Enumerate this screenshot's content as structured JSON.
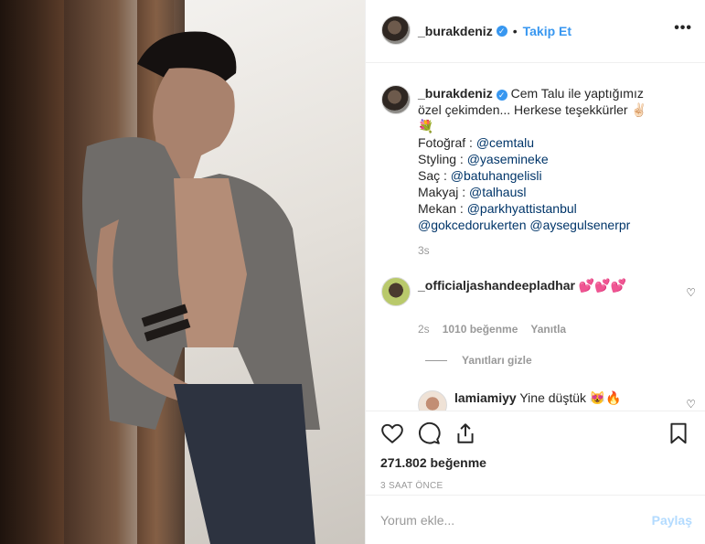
{
  "header": {
    "username": "_burakdeniz",
    "verified_icon": "verified-badge-icon",
    "dot": "•",
    "follow": "Takip Et",
    "more": "•••"
  },
  "caption": {
    "username": "_burakdeniz",
    "text": "Cem Talu ile yaptığımız özel çekimden... Herkese teşekkürler ✌🏻💐",
    "lines": [
      {
        "label": "Fotoğraf : ",
        "mention": "@cemtalu"
      },
      {
        "label": "Styling : ",
        "mention": "@yasemineke"
      },
      {
        "label": "Saç : ",
        "mention": "@batuhangelisli"
      },
      {
        "label": "Makyaj : ",
        "mention": "@talhausl"
      },
      {
        "label": "Mekan : ",
        "mention": "@parkhyattistanbul"
      }
    ],
    "extra_mentions": "@gokcedorukerten @aysegulsenerpr",
    "time": "3s"
  },
  "comment1": {
    "username": "_officialjashandeepladhar",
    "text": "💕💕💕",
    "time": "2s",
    "likes": "1010 beğenme",
    "reply": "Yanıtla"
  },
  "hide_replies": "Yanıtları gizle",
  "comment2": {
    "username": "lamiamiyy",
    "text": "Yine düştük 😻🔥"
  },
  "actions": {
    "likes": "271.802 beğenme",
    "ago": "3 SAAT ÖNCE"
  },
  "add_comment": {
    "placeholder": "Yorum ekle...",
    "share": "Paylaş"
  }
}
